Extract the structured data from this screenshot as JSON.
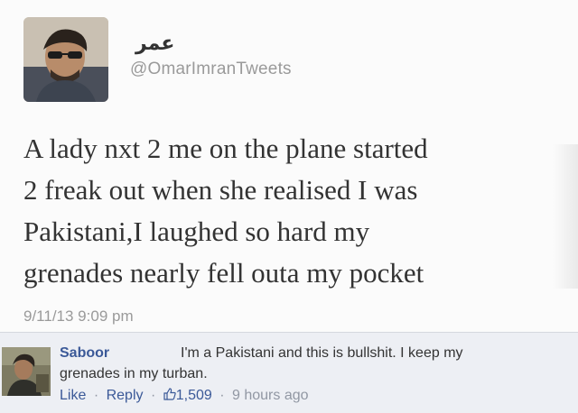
{
  "tweet": {
    "display_name": "عمر",
    "handle": "@OmarImranTweets",
    "text_lines": [
      "A lady nxt 2 me on the plane started",
      "2 freak out when she realised I was",
      "Pakistani,I laughed so hard my",
      "grenades nearly fell outa my pocket"
    ],
    "timestamp": "9/11/13 9:09 pm"
  },
  "comment": {
    "author": "Saboor",
    "text_line1": "I'm a Pakistani and this is bullshit. I keep my",
    "text_line2": "grenades in my turban.",
    "actions": {
      "like": "Like",
      "reply": "Reply",
      "like_count": "1,509",
      "time": "9 hours ago",
      "separator": "·"
    }
  },
  "colors": {
    "link_blue": "#3b5998",
    "muted_gray": "#9a9a9a",
    "comment_bg": "#edeff4"
  }
}
